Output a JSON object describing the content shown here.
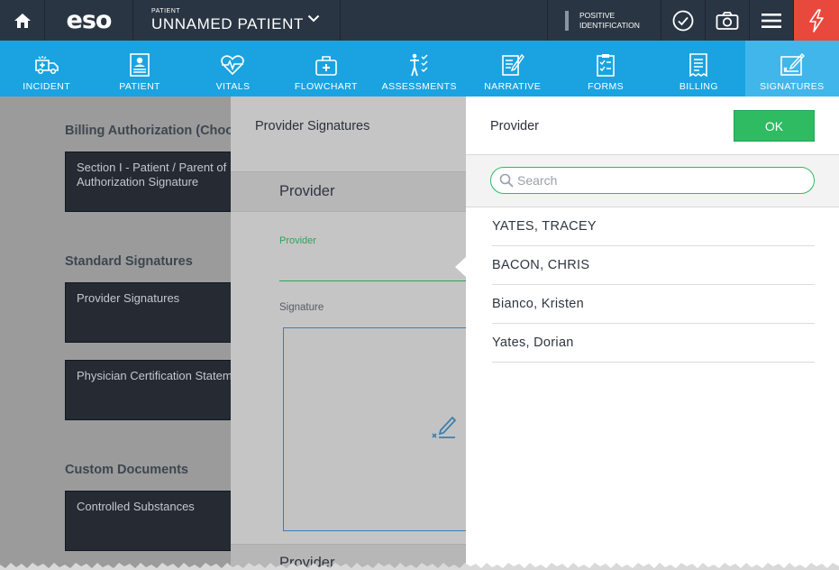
{
  "header": {
    "logo": "eso",
    "patient_label": "PATIENT",
    "patient_name": "UNNAMED PATIENT",
    "positive_id_line1": "POSITIVE",
    "positive_id_line2": "IDENTIFICATION"
  },
  "nav": {
    "items": [
      {
        "label": "INCIDENT",
        "icon": "ambulance-icon"
      },
      {
        "label": "PATIENT",
        "icon": "patient-card-icon"
      },
      {
        "label": "VITALS",
        "icon": "heartbeat-icon"
      },
      {
        "label": "FLOWCHART",
        "icon": "medical-kit-icon"
      },
      {
        "label": "ASSESSMENTS",
        "icon": "body-checklist-icon"
      },
      {
        "label": "NARRATIVE",
        "icon": "notepad-pen-icon"
      },
      {
        "label": "FORMS",
        "icon": "forms-icon"
      },
      {
        "label": "BILLING",
        "icon": "billing-icon"
      },
      {
        "label": "SIGNATURES",
        "icon": "signature-icon"
      }
    ],
    "active": "SIGNATURES"
  },
  "background_page": {
    "billing_heading": "Billing Authorization (Choo",
    "billing_card": "Section I - Patient / Parent of Authorization Signature",
    "standard_heading": "Standard Signatures",
    "provider_card": "Provider Signatures",
    "physician_card": "Physician Certification Statem",
    "custom_heading": "Custom Documents",
    "controlled_card": "Controlled Substances"
  },
  "middle_panel": {
    "title": "Provider Signatures",
    "section_title": "Provider",
    "provider_field_label": "Provider",
    "signature_label": "Signature",
    "next_section_title": "Provider"
  },
  "picker": {
    "title": "Provider",
    "ok_label": "OK",
    "search_placeholder": "Search",
    "search_value": "",
    "providers": [
      "YATES, TRACEY",
      "BACON, CHRIS",
      "Bianco, Kristen",
      "Yates, Dorian"
    ]
  },
  "colors": {
    "topbar": "#2a3543",
    "nav": "#1aa3e0",
    "nav_active": "#40b6ea",
    "alert": "#e8493c",
    "ok_green": "#2ebb62"
  }
}
